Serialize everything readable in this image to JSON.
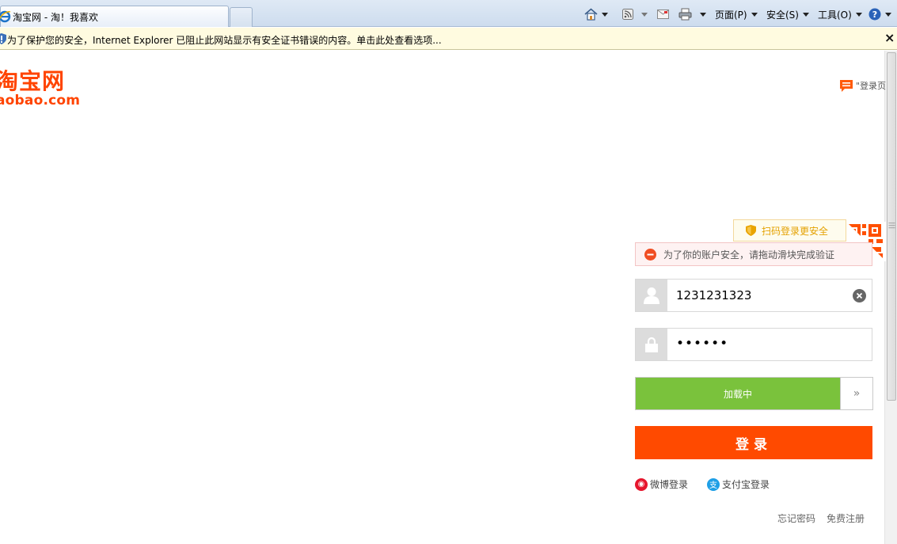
{
  "browser": {
    "tab_title": "淘宝网 - 淘！我喜欢",
    "menu": {
      "page": "页面(P)",
      "safety": "安全(S)",
      "tools": "工具(O)"
    },
    "icons": [
      "home-icon",
      "rss-icon",
      "mail-icon",
      "print-icon",
      "help-icon"
    ],
    "info_bar_text": "为了保护您的安全，Internet Explorer 已阻止此网站显示有安全证书错误的内容。单击此处查看选项...",
    "info_close": "×"
  },
  "page": {
    "logo_cn": "淘宝网",
    "logo_en": "aobao.com",
    "feedback_label": "\"登录页"
  },
  "login": {
    "qr_tip": "扫码登录更安全",
    "alert_text": "为了你的账户安全，请拖动滑块完成验证",
    "username_value": "1231231323",
    "password_mask": "••••••",
    "slider_text": "加载中",
    "slider_handle": "»",
    "submit_label": "登录",
    "alt_logins": [
      {
        "label": "微博登录",
        "icon": "weibo-icon",
        "color": "#e6162d"
      },
      {
        "label": "支付宝登录",
        "icon": "alipay-icon",
        "color": "#1e9fe6"
      }
    ],
    "forgot_password": "忘记密码",
    "register": "免费注册"
  },
  "colors": {
    "brand_orange": "#ff4400",
    "slider_green": "#7ac23c",
    "button_orange": "#ff4a00"
  }
}
